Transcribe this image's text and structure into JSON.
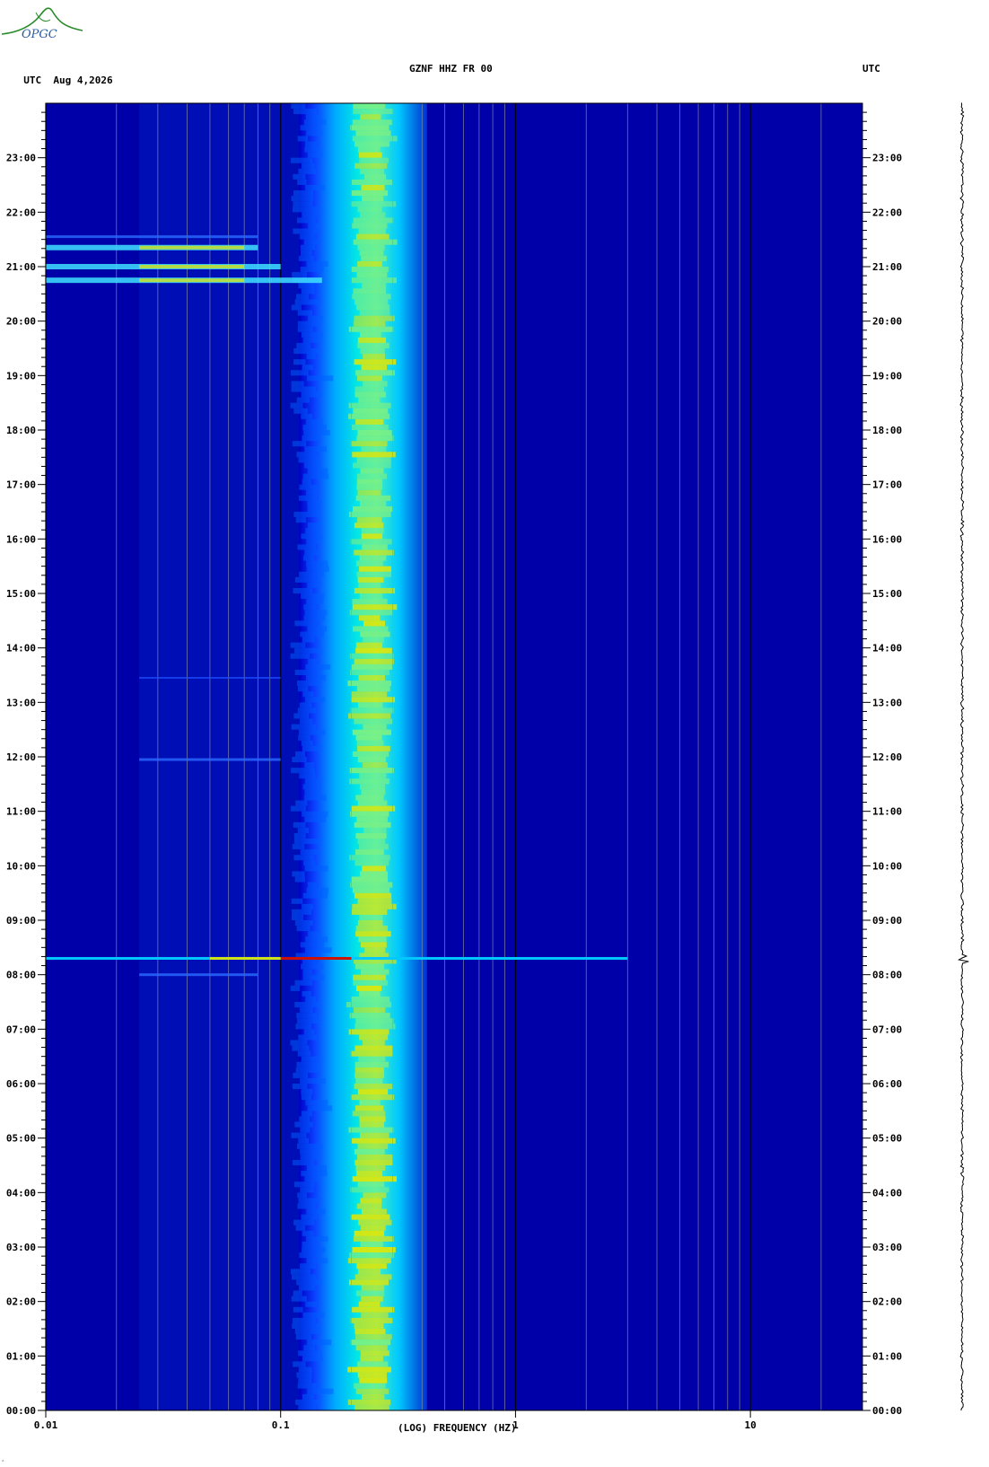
{
  "header": {
    "left_tz": "UTC",
    "date": "Aug 4,2026",
    "channel": "GZNF HHZ FR 00",
    "right_tz": "UTC"
  },
  "logo_text": "OPGC",
  "colors": {
    "background": "#0000a8",
    "gridline": "#9a9a9a",
    "decade_line": "#000000",
    "band_cyan": "#00e6e6",
    "band_yellow": "#e6e600",
    "event_red": "#d01000"
  },
  "chart_data": {
    "type": "heatmap",
    "title": "GZNF HHZ FR 00",
    "xlabel": "(LOG) FREQUENCY (HZ)",
    "ylabel": "",
    "x_scale": "log",
    "xlim": [
      0.01,
      30
    ],
    "x_ticks": [
      {
        "value": 0.01,
        "label": "0.01"
      },
      {
        "value": 0.1,
        "label": "0.1"
      },
      {
        "value": 1,
        "label": "1"
      },
      {
        "value": 10,
        "label": "10"
      }
    ],
    "ylim_hours": [
      0,
      24
    ],
    "y_ticks": [
      "00:00",
      "01:00",
      "02:00",
      "03:00",
      "04:00",
      "05:00",
      "06:00",
      "07:00",
      "08:00",
      "09:00",
      "10:00",
      "11:00",
      "12:00",
      "13:00",
      "14:00",
      "15:00",
      "16:00",
      "17:00",
      "18:00",
      "19:00",
      "20:00",
      "21:00",
      "22:00",
      "23:00"
    ],
    "microseism_band_hz": [
      0.12,
      0.42
    ],
    "microseism_peak_hz": [
      0.2,
      0.3
    ],
    "events": [
      {
        "time_hour": 8.3,
        "fmin_hz": 0.01,
        "fmax_hz": 3,
        "strength": "strong"
      },
      {
        "time_hour": 8.0,
        "fmin_hz": 0.025,
        "fmax_hz": 0.08,
        "strength": "weak"
      },
      {
        "time_hour": 11.95,
        "fmin_hz": 0.025,
        "fmax_hz": 0.1,
        "strength": "weak"
      },
      {
        "time_hour": 13.45,
        "fmin_hz": 0.025,
        "fmax_hz": 0.1,
        "strength": "faint"
      },
      {
        "time_hour": 20.75,
        "fmin_hz": 0.01,
        "fmax_hz": 0.15,
        "strength": "moderate"
      },
      {
        "time_hour": 21.0,
        "fmin_hz": 0.01,
        "fmax_hz": 0.1,
        "strength": "moderate"
      },
      {
        "time_hour": 21.35,
        "fmin_hz": 0.01,
        "fmax_hz": 0.08,
        "strength": "moderate"
      },
      {
        "time_hour": 21.55,
        "fmin_hz": 0.01,
        "fmax_hz": 0.08,
        "strength": "weak"
      }
    ],
    "grid": true
  }
}
